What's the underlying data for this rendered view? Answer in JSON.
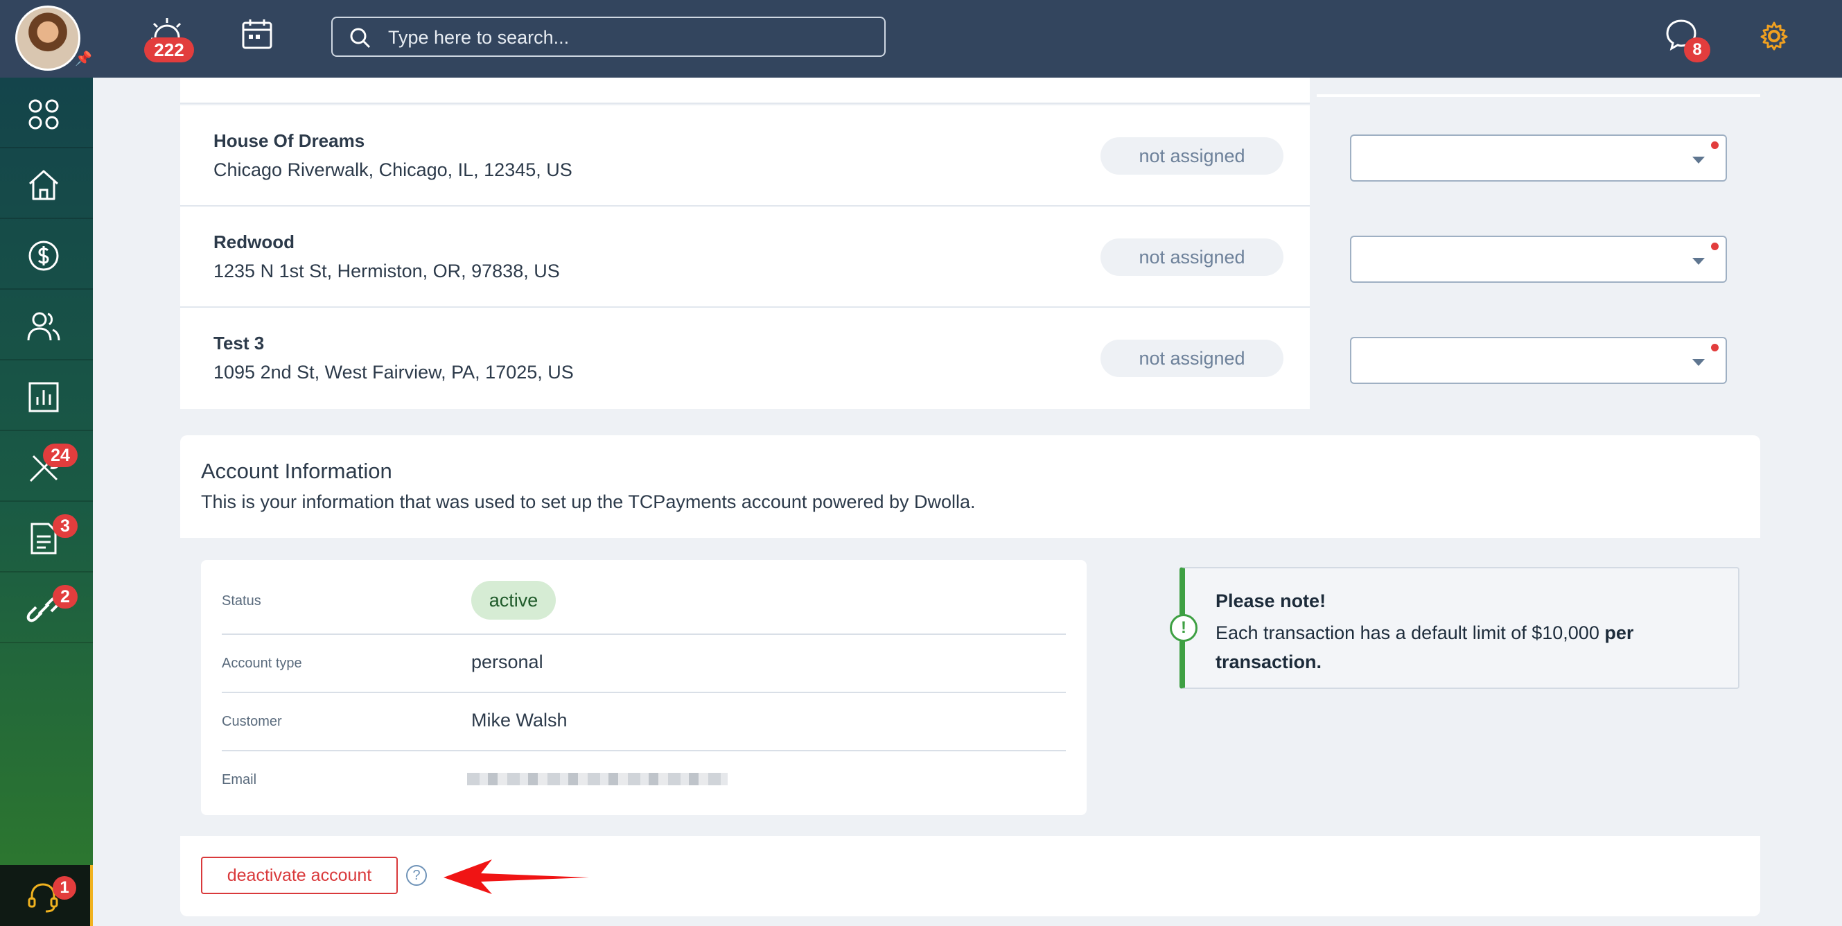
{
  "header": {
    "alerts_badge": "222",
    "search_placeholder": "Type here to search...",
    "messages_badge": "8"
  },
  "sidebar": {
    "badges": {
      "maintenance": "24",
      "documents": "3",
      "links": "2",
      "support": "1"
    }
  },
  "properties": [
    {
      "name": "House Of Dreams",
      "address": "Chicago Riverwalk, Chicago, IL, 12345, US",
      "status": "not assigned"
    },
    {
      "name": "Redwood",
      "address": "1235 N 1st St, Hermiston, OR, 97838, US",
      "status": "not assigned"
    },
    {
      "name": "Test 3",
      "address": "1095 2nd St, West Fairview, PA, 17025, US",
      "status": "not assigned"
    }
  ],
  "account": {
    "title": "Account Information",
    "subtitle": "This is your information that was used to set up the TCPayments account powered by Dwolla.",
    "status_label": "Status",
    "status_value": "active",
    "type_label": "Account type",
    "type_value": "personal",
    "customer_label": "Customer",
    "customer_value": "Mike Walsh",
    "email_label": "Email"
  },
  "note": {
    "title": "Please note!",
    "body_prefix": "Each transaction has a default limit of $10,000 ",
    "body_bold": "per transaction."
  },
  "actions": {
    "deactivate_label": "deactivate account",
    "help_symbol": "?"
  },
  "colors": {
    "topbar": "#33455e",
    "accent_red": "#d9393b",
    "success_green": "#3ea043",
    "gear_orange": "#f0a020"
  }
}
